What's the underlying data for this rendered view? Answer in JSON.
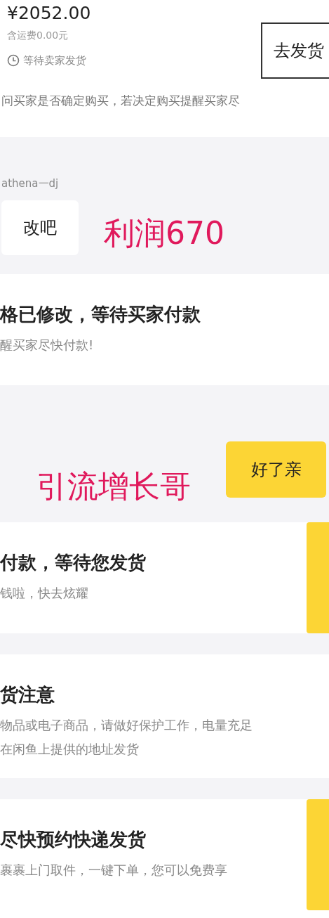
{
  "blocks": [
    {
      "kind": "order",
      "price": "¥2052.00",
      "shipping": "含运费0.00元",
      "status": "等待卖家发货",
      "action": "去发货"
    },
    {
      "kind": "notice",
      "text": "问买家是否确定购买，若决定购买提醒买家尽"
    },
    {
      "kind": "bubble",
      "outgoing": false,
      "sender": "athena一dj",
      "text": "改吧",
      "annotation": "利润670"
    },
    {
      "kind": "card",
      "title": "格已修改，等待买家付款",
      "lines": [
        "醒买家尽快付款!"
      ],
      "button": false
    },
    {
      "kind": "bubble",
      "outgoing": true,
      "text": "好了亲",
      "annotation": "引流增长哥"
    },
    {
      "kind": "card",
      "title": "付款，等待您发货",
      "lines": [
        "钱啦，快去炫耀"
      ],
      "button": true
    },
    {
      "kind": "card",
      "title": "货注意",
      "lines": [
        "物品或电子商品，请做好保护工作，电量充足",
        "在闲鱼上提供的地址发货"
      ],
      "button": false
    },
    {
      "kind": "card",
      "title": "尽快预约快递发货",
      "lines": [
        "裹裹上门取件，一键下单，您可以免费享"
      ],
      "button": true
    }
  ]
}
